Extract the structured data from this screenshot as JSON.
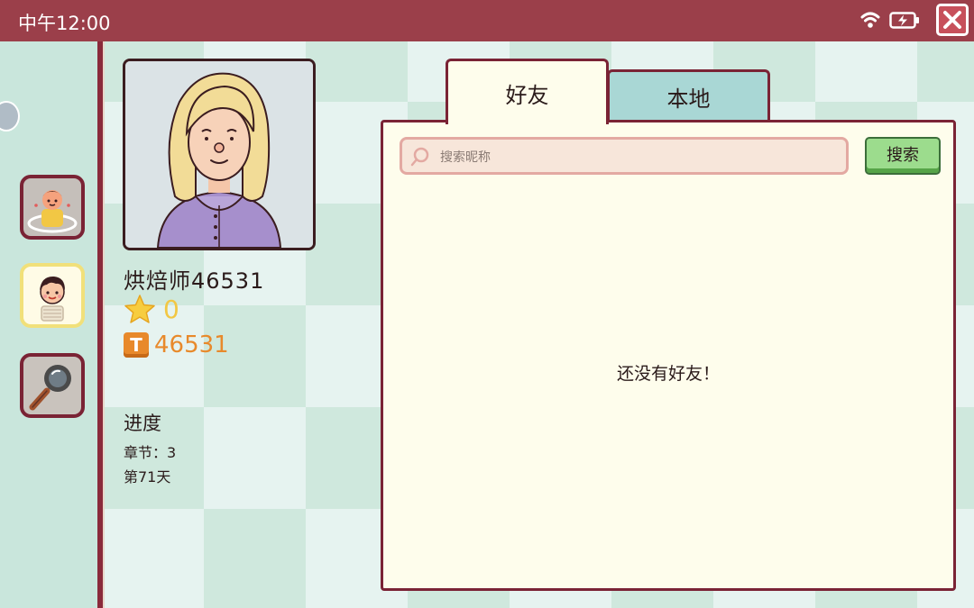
{
  "status_bar": {
    "time": "中午12:00",
    "icons": [
      "wifi-icon",
      "battery-charging-icon",
      "close-icon"
    ]
  },
  "sidebar": {
    "items": [
      {
        "id": "profile",
        "icon": "character-profile-icon"
      },
      {
        "id": "friends",
        "icon": "friend-avatar-icon",
        "selected": true
      },
      {
        "id": "search",
        "icon": "magnifier-icon"
      }
    ]
  },
  "profile": {
    "name": "烘焙师46531",
    "stars": "0",
    "coins": "46531",
    "coin_badge": "T",
    "progress_title": "进度",
    "chapter": "章节：3",
    "day": "第71天"
  },
  "tabs": [
    {
      "label": "好友",
      "active": true
    },
    {
      "label": "本地",
      "active": false
    }
  ],
  "search": {
    "placeholder": "搜索昵称",
    "value": "",
    "button_label": "搜索"
  },
  "friends_list": {
    "empty_message": "还没有好友！"
  },
  "colors": {
    "header": "#9b3f4a",
    "border": "#7a2335",
    "panel_bg": "#fefdec",
    "tab_inactive": "#a9d7d5",
    "search_button": "#9cdc8d",
    "star": "#f2c744",
    "coin": "#e8892b"
  }
}
